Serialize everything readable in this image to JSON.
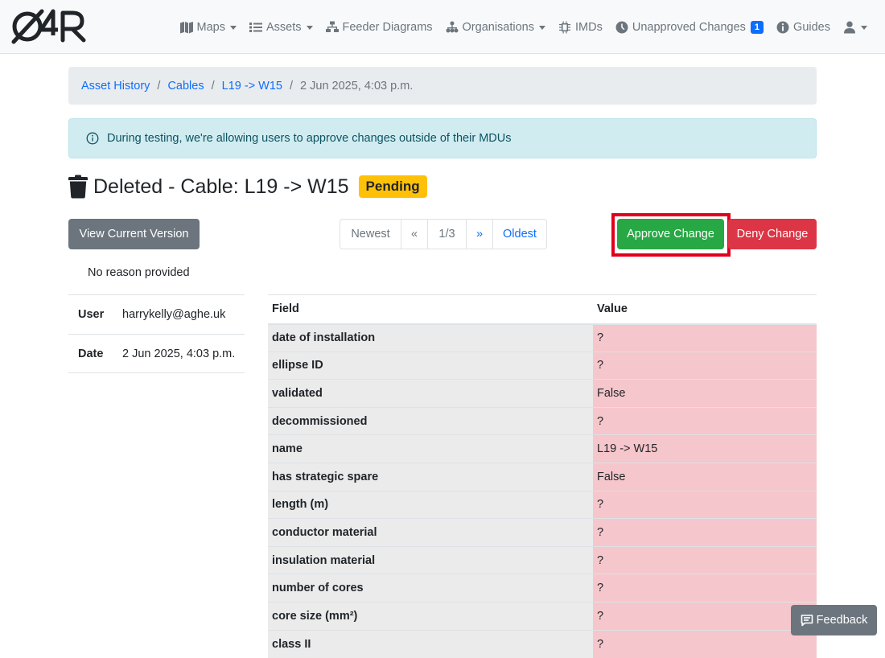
{
  "nav": {
    "brand": "O4R",
    "items": [
      {
        "label": "Maps",
        "icon": "map-icon",
        "dropdown": true
      },
      {
        "label": "Assets",
        "icon": "list-icon",
        "dropdown": true
      },
      {
        "label": "Feeder Diagrams",
        "icon": "sitemap-icon",
        "dropdown": false
      },
      {
        "label": "Organisations",
        "icon": "org-chart-icon",
        "dropdown": true
      },
      {
        "label": "IMDs",
        "icon": "chip-icon",
        "dropdown": false
      },
      {
        "label": "Unapproved Changes",
        "icon": "clock-icon",
        "dropdown": false,
        "badge": "1"
      },
      {
        "label": "Guides",
        "icon": "info-icon",
        "dropdown": false
      }
    ],
    "user_icon": "user-icon"
  },
  "breadcrumb": {
    "items": [
      "Asset History",
      "Cables",
      "L19 -> W15"
    ],
    "current": "2 Jun 2025, 4:03 p.m."
  },
  "alert": {
    "text": "During testing, we're allowing users to approve changes outside of their MDUs",
    "icon": "info-circle-icon"
  },
  "title": {
    "icon": "trash-icon",
    "text": "Deleted - Cable: L19 -> W15",
    "status": "Pending"
  },
  "toolbar": {
    "view_current": "View Current Version",
    "approve": "Approve Change",
    "deny": "Deny Change",
    "pager": {
      "newest": "Newest",
      "prev": "«",
      "page": "1/3",
      "next": "»",
      "oldest": "Oldest"
    }
  },
  "reason": "No reason provided",
  "meta": [
    {
      "key": "User",
      "value": "harrykelly@aghe.uk"
    },
    {
      "key": "Date",
      "value": "2 Jun 2025, 4:03 p.m."
    }
  ],
  "table": {
    "headers": {
      "field": "Field",
      "value": "Value"
    },
    "rows": [
      {
        "field": "date of installation",
        "value": "?"
      },
      {
        "field": "ellipse ID",
        "value": "?"
      },
      {
        "field": "validated",
        "value": "False"
      },
      {
        "field": "decommissioned",
        "value": "?"
      },
      {
        "field": "name",
        "value": "L19 -> W15"
      },
      {
        "field": "has strategic spare",
        "value": "False"
      },
      {
        "field": "length (m)",
        "value": "?"
      },
      {
        "field": "conductor material",
        "value": "?"
      },
      {
        "field": "insulation material",
        "value": "?"
      },
      {
        "field": "number of cores",
        "value": "?"
      },
      {
        "field": "core size (mm²)",
        "value": "?"
      },
      {
        "field": "class II",
        "value": "?"
      }
    ]
  },
  "feedback": {
    "label": "Feedback",
    "icon": "comment-icon"
  },
  "colors": {
    "approve": "#28a745",
    "deny": "#dc3545",
    "pending": "#ffc107",
    "deleted_value_bg": "#f5c6cb",
    "link": "#0d6efd"
  }
}
